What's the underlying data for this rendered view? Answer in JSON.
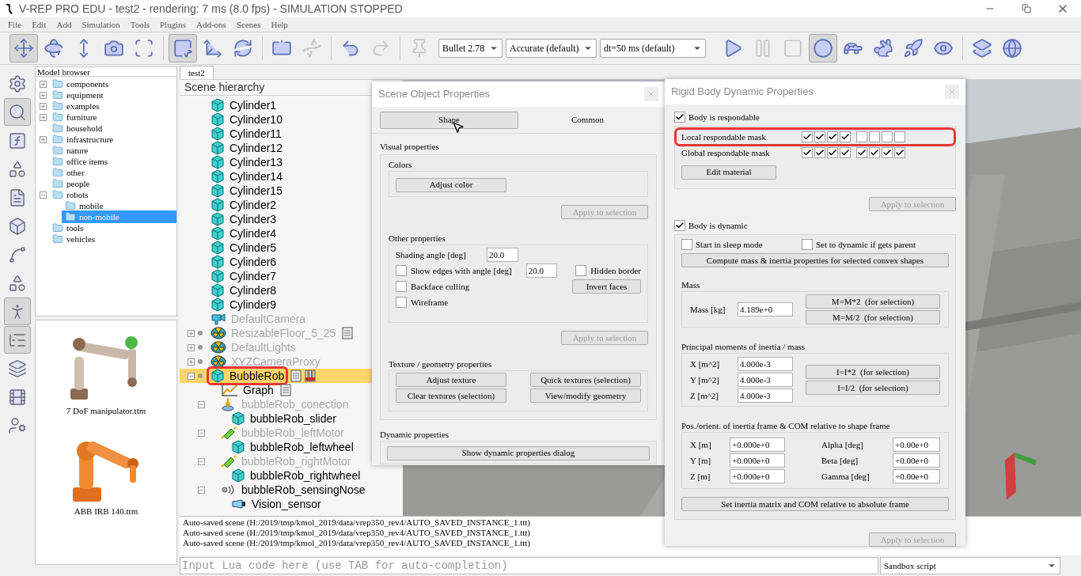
{
  "window": {
    "title": "V-REP PRO EDU - test2 - rendering: 7 ms (8.0 fps) - SIMULATION STOPPED"
  },
  "menu": [
    "File",
    "Edit",
    "Add",
    "Simulation",
    "Tools",
    "Plugins",
    "Add-ons",
    "Scenes",
    "Help"
  ],
  "toolbar": {
    "left_buttons": [
      {
        "selected": true,
        "disabled": false
      },
      {
        "selected": false,
        "disabled": false
      },
      {
        "selected": false,
        "disabled": false
      },
      {
        "selected": false,
        "disabled": false
      },
      {
        "selected": false,
        "disabled": false
      },
      {
        "selected": true,
        "disabled": false
      },
      {
        "selected": false,
        "disabled": false
      },
      {
        "selected": false,
        "disabled": false
      },
      {
        "selected": false,
        "disabled": false
      },
      {
        "selected": false,
        "disabled": true
      },
      {
        "selected": false,
        "disabled": false
      },
      {
        "selected": false,
        "disabled": true
      },
      {
        "selected": false,
        "disabled": true
      }
    ],
    "engine": "Bullet 2.78",
    "accuracy": "Accurate (default)",
    "timestep": "dt=50 ms (default)",
    "right_buttons": [
      {
        "selected": false,
        "disabled": false
      },
      {
        "selected": false,
        "disabled": true
      },
      {
        "selected": false,
        "disabled": true
      },
      {
        "selected": true,
        "disabled": false
      },
      {
        "selected": false,
        "disabled": false
      },
      {
        "selected": false,
        "disabled": false
      },
      {
        "selected": false,
        "disabled": false
      },
      {
        "selected": false,
        "disabled": false
      },
      {
        "selected": false,
        "disabled": false
      },
      {
        "selected": false,
        "disabled": false
      }
    ]
  },
  "side_strip": [
    {
      "selected": false
    },
    {
      "selected": true
    },
    {
      "selected": false
    },
    {
      "selected": false
    },
    {
      "selected": false
    },
    {
      "selected": false
    },
    {
      "selected": false
    },
    {
      "selected": false
    },
    {
      "selected": true
    },
    {
      "selected": true
    },
    {
      "selected": false
    },
    {
      "selected": false
    },
    {
      "selected": false
    }
  ],
  "model_browser": {
    "title": "Model browser",
    "folders": [
      {
        "name": "components",
        "expanded": false,
        "selected": false
      },
      {
        "name": "equipment",
        "expanded": false,
        "selected": false
      },
      {
        "name": "examples",
        "expanded": false,
        "selected": false
      },
      {
        "name": "furniture",
        "expanded": false,
        "selected": false
      },
      {
        "name": "household",
        "selected": false
      },
      {
        "name": "infrastructure",
        "expanded": false,
        "selected": false
      },
      {
        "name": "nature",
        "selected": false
      },
      {
        "name": "office items",
        "selected": false
      },
      {
        "name": "other",
        "selected": false
      },
      {
        "name": "people",
        "selected": false
      },
      {
        "name": "robots",
        "expanded": true,
        "selected": false,
        "children": [
          {
            "name": "mobile",
            "selected": false
          },
          {
            "name": "non-mobile",
            "selected": true
          }
        ]
      },
      {
        "name": "tools",
        "selected": false
      },
      {
        "name": "vehicles",
        "selected": false
      }
    ],
    "models": [
      {
        "name": "7 DoF manipulator.ttm",
        "kind": "picture"
      },
      {
        "name": "ABB IRB 140.ttm",
        "kind": "picture"
      }
    ]
  },
  "scene_tabs": [
    {
      "label": "test2",
      "selected": true
    }
  ],
  "scene_hierarchy": {
    "title": "Scene hierarchy",
    "items": [
      {
        "name": "Cylinder1",
        "kind": "shape",
        "dimmed": false,
        "selected": false,
        "highlighted": false
      },
      {
        "name": "Cylinder10",
        "kind": "shape",
        "dimmed": false,
        "selected": false,
        "highlighted": false
      },
      {
        "name": "Cylinder11",
        "kind": "shape",
        "dimmed": false,
        "selected": false,
        "highlighted": false
      },
      {
        "name": "Cylinder12",
        "kind": "shape",
        "dimmed": false,
        "selected": false,
        "highlighted": false
      },
      {
        "name": "Cylinder13",
        "kind": "shape",
        "dimmed": false,
        "selected": false,
        "highlighted": false
      },
      {
        "name": "Cylinder14",
        "kind": "shape",
        "dimmed": false,
        "selected": false,
        "highlighted": false
      },
      {
        "name": "Cylinder15",
        "kind": "shape",
        "dimmed": false,
        "selected": false,
        "highlighted": false
      },
      {
        "name": "Cylinder2",
        "kind": "shape",
        "dimmed": false,
        "selected": false,
        "highlighted": false
      },
      {
        "name": "Cylinder3",
        "kind": "shape",
        "dimmed": false,
        "selected": false,
        "highlighted": false
      },
      {
        "name": "Cylinder4",
        "kind": "shape",
        "dimmed": false,
        "selected": false,
        "highlighted": false
      },
      {
        "name": "Cylinder5",
        "kind": "shape",
        "dimmed": false,
        "selected": false,
        "highlighted": false
      },
      {
        "name": "Cylinder6",
        "kind": "shape",
        "dimmed": false,
        "selected": false,
        "highlighted": false
      },
      {
        "name": "Cylinder7",
        "kind": "shape",
        "dimmed": false,
        "selected": false,
        "highlighted": false
      },
      {
        "name": "Cylinder8",
        "kind": "shape",
        "dimmed": false,
        "selected": false,
        "highlighted": false
      },
      {
        "name": "Cylinder9",
        "kind": "shape",
        "dimmed": false,
        "selected": false,
        "highlighted": false
      },
      {
        "name": "DefaultCamera",
        "kind": "camera",
        "dimmed": true,
        "selected": false,
        "highlighted": false
      },
      {
        "name": "ResizableFloor_5_25",
        "kind": "dummy",
        "expanded": false,
        "dimmed": true,
        "selected": false,
        "highlighted": false,
        "model_base": true,
        "badges": [
          {
            "kind": "script"
          }
        ]
      },
      {
        "name": "DefaultLights",
        "kind": "dummy",
        "expanded": false,
        "dimmed": true,
        "selected": false,
        "highlighted": false,
        "model_base": true
      },
      {
        "name": "XYZCameraProxy",
        "kind": "dummy",
        "expanded": false,
        "dimmed": true,
        "selected": false,
        "highlighted": false,
        "model_base": true
      },
      {
        "name": "BubbleRob",
        "kind": "shape",
        "expanded": true,
        "dimmed": false,
        "selected": true,
        "highlighted": true,
        "model_base": true,
        "badges": [
          {
            "kind": "script"
          },
          {
            "kind": "custom_ui"
          }
        ],
        "children": [
          {
            "name": "Graph",
            "kind": "graph",
            "dimmed": false,
            "selected": false,
            "highlighted": false,
            "badges": [
              {
                "kind": "script"
              }
            ]
          },
          {
            "name": "bubbleRob_conection",
            "kind": "force_sensor",
            "expanded": true,
            "dimmed": true,
            "selected": false,
            "highlighted": false,
            "children": [
              {
                "name": "bubbleRob_slider",
                "kind": "shape",
                "dimmed": false,
                "selected": false,
                "highlighted": false
              }
            ]
          },
          {
            "name": "bubbleRob_leftMotor",
            "kind": "joint",
            "expanded": true,
            "dimmed": true,
            "selected": false,
            "highlighted": false,
            "children": [
              {
                "name": "bubbleRob_leftwheel",
                "kind": "shape",
                "dimmed": false,
                "selected": false,
                "highlighted": false
              }
            ]
          },
          {
            "name": "bubbleRob_rightMotor",
            "kind": "joint",
            "expanded": true,
            "dimmed": true,
            "selected": false,
            "highlighted": false,
            "children": [
              {
                "name": "bubbleRob_rightwheel",
                "kind": "shape",
                "dimmed": false,
                "selected": false,
                "highlighted": false
              }
            ]
          },
          {
            "name": "bubbleRob_sensingNose",
            "kind": "proximity",
            "expanded": true,
            "dimmed": false,
            "selected": false,
            "highlighted": false,
            "children": [
              {
                "name": "Vision_sensor",
                "kind": "vision",
                "dimmed": false,
                "selected": false,
                "highlighted": false
              }
            ]
          }
        ]
      }
    ]
  },
  "object_properties": {
    "title": "Scene Object Properties",
    "tabs": [
      {
        "label": "Shape",
        "selected": true
      },
      {
        "label": "Common",
        "selected": false
      }
    ],
    "visual_label": "Visual properties",
    "colors_label": "Colors",
    "adjust_color": "Adjust color",
    "apply_1": {
      "label": "Apply to selection",
      "disabled": true
    },
    "other_label": "Other properties",
    "shading_label": "Shading angle [deg]",
    "shading_value": "20.0",
    "show_edges": {
      "label": "Show edges with angle [deg]",
      "checked": false
    },
    "edge_value": "20.0",
    "hidden_border": {
      "label": "Hidden border",
      "checked": false
    },
    "invert_faces": "Invert faces",
    "backface": {
      "label": "Backface culling",
      "checked": false
    },
    "wireframe": {
      "label": "Wireframe",
      "checked": false
    },
    "apply_2": {
      "label": "Apply to selection",
      "disabled": true
    },
    "texture_label": "Texture / geometry properties",
    "texture_buttons": [
      "Adjust texture",
      "Quick textures (selection)",
      "Clear textures (selection)",
      "View/modify geometry"
    ],
    "dynamic_label": "Dynamic properties",
    "dynamic_button": "Show dynamic properties dialog"
  },
  "dynamics": {
    "title": "Rigid Body Dynamic Properties",
    "respondable": {
      "label": "Body is respondable",
      "checked": true
    },
    "local_mask": {
      "label": "Local respondable mask",
      "bits": [
        true,
        true,
        true,
        true,
        false,
        false,
        false,
        false
      ],
      "highlighted": true
    },
    "global_mask": {
      "label": "Global respondable mask",
      "bits": [
        true,
        true,
        true,
        true,
        true,
        true,
        true,
        true
      ],
      "highlighted": false
    },
    "edit_material": "Edit material",
    "apply_1": {
      "label": "Apply to selection",
      "disabled": true
    },
    "dynamic": {
      "label": "Body is dynamic",
      "checked": true
    },
    "sleep": {
      "label": "Start in sleep mode",
      "checked": false
    },
    "set_dynamic": {
      "label": "Set to dynamic if gets parent",
      "checked": false
    },
    "compute": "Compute mass & inertia properties for selected convex shapes",
    "mass_label": "Mass",
    "mass_field": {
      "label": "Mass [kg]",
      "value": "4.189e+0"
    },
    "mass_buttons": [
      "M=M*2  (for selection)",
      "M=M/2  (for selection)"
    ],
    "inertia_label": "Principal moments of inertia / mass",
    "inertia_fields": [
      {
        "label": "X [m^2]",
        "value": "4.000e-3"
      },
      {
        "label": "Y [m^2]",
        "value": "4.000e-3"
      },
      {
        "label": "Z [m^2]",
        "value": "4.000e-3"
      }
    ],
    "inertia_buttons": [
      "I=I*2  (for selection)",
      "I=I/2  (for selection)"
    ],
    "frame_label": "Pos./orient. of inertia frame & COM relative to shape frame",
    "position_fields": [
      {
        "label": "X [m]",
        "value": "+0.000e+0"
      },
      {
        "label": "Y [m]",
        "value": "+0.000e+0"
      },
      {
        "label": "Z [m]",
        "value": "+0.000e+0"
      }
    ],
    "orientation_fields": [
      {
        "label": "Alpha [deg]",
        "value": "+0.00e+0"
      },
      {
        "label": "Beta [deg]",
        "value": "+0.00e+0"
      },
      {
        "label": "Gamma [deg]",
        "value": "+0.00e+0"
      }
    ],
    "set_inertia": "Set inertia matrix and COM relative to absolute frame",
    "apply_2": {
      "label": "Apply to selection",
      "disabled": true
    }
  },
  "console": {
    "lines": [
      "Auto-saved scene (H:/2019/tmp/kmol_2019/data/vrep350_rev4/AUTO_SAVED_INSTANCE_1.ttt)",
      "Auto-saved scene (H:/2019/tmp/kmol_2019/data/vrep350_rev4/AUTO_SAVED_INSTANCE_1.ttt)",
      "Auto-saved scene (H:/2019/tmp/kmol_2019/data/vrep350_rev4/AUTO_SAVED_INSTANCE_1.ttt)"
    ],
    "lua_placeholder": "Input Lua code here (use TAB for auto-completion)",
    "script_selector": "Sandbox script"
  }
}
